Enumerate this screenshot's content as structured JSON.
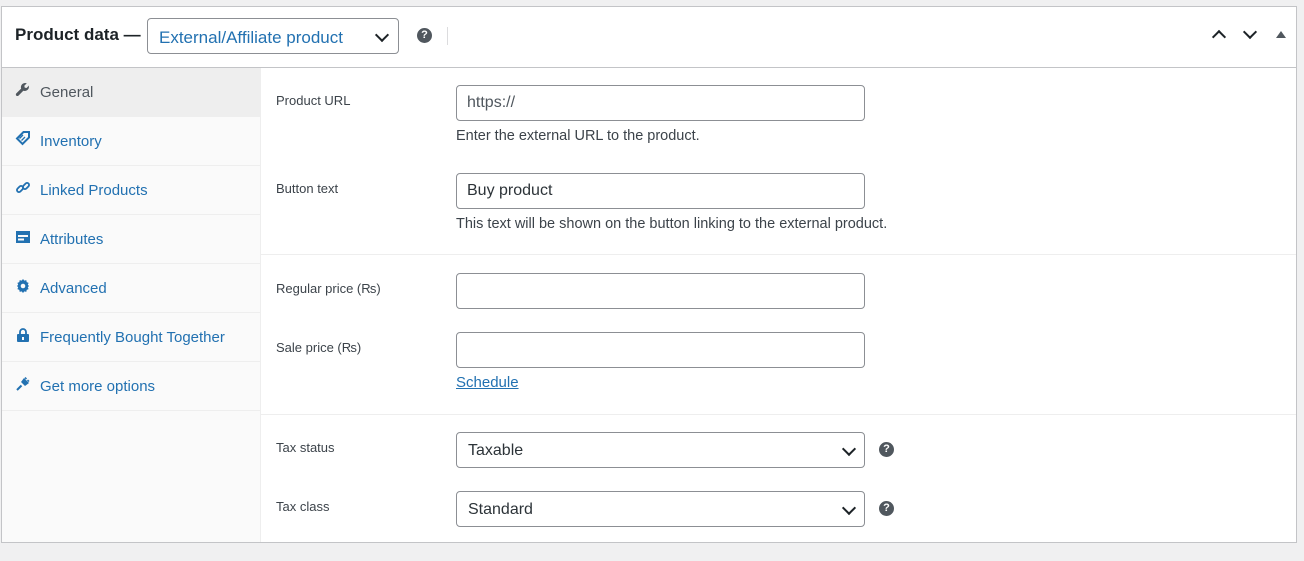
{
  "header": {
    "title": "Product data —",
    "product_type": "External/Affiliate product",
    "help_icon": "?"
  },
  "sidebar": {
    "items": [
      {
        "label": "General",
        "icon": "wrench-icon"
      },
      {
        "label": "Inventory",
        "icon": "tag-icon"
      },
      {
        "label": "Linked Products",
        "icon": "link-icon"
      },
      {
        "label": "Attributes",
        "icon": "table-icon"
      },
      {
        "label": "Advanced",
        "icon": "gear-icon"
      },
      {
        "label": "Frequently Bought Together",
        "icon": "lock-bag-icon"
      },
      {
        "label": "Get more options",
        "icon": "plugin-icon"
      }
    ]
  },
  "general": {
    "product_url": {
      "label": "Product URL",
      "placeholder": "https://",
      "value": "",
      "description": "Enter the external URL to the product."
    },
    "button_text": {
      "label": "Button text",
      "placeholder": "",
      "value": "Buy product",
      "description": "This text will be shown on the button linking to the external product."
    },
    "regular_price": {
      "label": "Regular price (₨)",
      "value": ""
    },
    "sale_price": {
      "label": "Sale price (₨)",
      "value": ""
    },
    "schedule_link": "Schedule",
    "tax_status": {
      "label": "Tax status",
      "value": "Taxable"
    },
    "tax_class": {
      "label": "Tax class",
      "value": "Standard"
    }
  }
}
